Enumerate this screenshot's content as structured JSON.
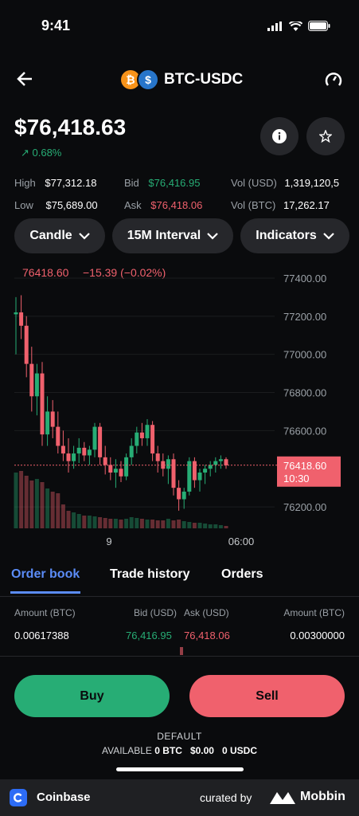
{
  "status": {
    "time": "9:41"
  },
  "header": {
    "pair": "BTC-USDC",
    "back_icon": "arrow-left-icon",
    "gauge_icon": "gauge-icon"
  },
  "price": {
    "value": "$76,418.63",
    "change": "↗ 0.68%"
  },
  "stats": {
    "high_label": "High",
    "high": "$77,312.18",
    "low_label": "Low",
    "low": "$75,689.00",
    "bid_label": "Bid",
    "bid": "$76,416.95",
    "ask_label": "Ask",
    "ask": "$76,418.06",
    "vol_usd_label": "Vol (USD)",
    "vol_usd": "1,319,120,5",
    "vol_btc_label": "Vol (BTC)",
    "vol_btc": "17,262.17"
  },
  "controls": {
    "candle": "Candle",
    "interval": "15M Interval",
    "indicators": "Indicators"
  },
  "chart_header": {
    "price": "76418.60",
    "change": "−15.39 (−0.02%)"
  },
  "chart_data": {
    "type": "candlestick",
    "y_ticks": [
      "77400.00",
      "77200.00",
      "77000.00",
      "76800.00",
      "76600.00",
      "76200.00"
    ],
    "x_ticks": [
      "9",
      "06:00"
    ],
    "current_price_label": "76418.60",
    "countdown_label": "10:30",
    "ylim": [
      76100,
      77450
    ],
    "candles": [
      [
        77210,
        77300,
        77000,
        77220
      ],
      [
        77220,
        77310,
        77080,
        77150
      ],
      [
        77150,
        77200,
        76880,
        76950
      ],
      [
        76950,
        77040,
        76700,
        76780
      ],
      [
        76780,
        76950,
        76680,
        76900
      ],
      [
        76900,
        76960,
        76520,
        76580
      ],
      [
        76580,
        76780,
        76520,
        76700
      ],
      [
        76700,
        76760,
        76560,
        76620
      ],
      [
        76620,
        76700,
        76480,
        76520
      ],
      [
        76520,
        76600,
        76440,
        76480
      ],
      [
        76480,
        76560,
        76380,
        76440
      ],
      [
        76440,
        76520,
        76400,
        76480
      ],
      [
        76480,
        76560,
        76430,
        76510
      ],
      [
        76510,
        76540,
        76440,
        76470
      ],
      [
        76470,
        76520,
        76420,
        76500
      ],
      [
        76500,
        76640,
        76460,
        76620
      ],
      [
        76620,
        76640,
        76420,
        76460
      ],
      [
        76460,
        76520,
        76370,
        76420
      ],
      [
        76420,
        76460,
        76340,
        76380
      ],
      [
        76380,
        76450,
        76300,
        76400
      ],
      [
        76400,
        76440,
        76330,
        76360
      ],
      [
        76360,
        76480,
        76340,
        76460
      ],
      [
        76460,
        76560,
        76420,
        76520
      ],
      [
        76520,
        76620,
        76480,
        76590
      ],
      [
        76590,
        76640,
        76520,
        76560
      ],
      [
        76560,
        76660,
        76520,
        76630
      ],
      [
        76630,
        76650,
        76440,
        76480
      ],
      [
        76480,
        76520,
        76380,
        76440
      ],
      [
        76440,
        76480,
        76360,
        76400
      ],
      [
        76400,
        76470,
        76320,
        76450
      ],
      [
        76450,
        76480,
        76260,
        76300
      ],
      [
        76300,
        76340,
        76180,
        76240
      ],
      [
        76240,
        76300,
        76190,
        76280
      ],
      [
        76280,
        76460,
        76260,
        76440
      ],
      [
        76440,
        76460,
        76300,
        76340
      ],
      [
        76340,
        76400,
        76280,
        76380
      ],
      [
        76380,
        76420,
        76320,
        76400
      ],
      [
        76400,
        76440,
        76360,
        76420
      ],
      [
        76420,
        76460,
        76380,
        76440
      ],
      [
        76440,
        76470,
        76400,
        76450
      ],
      [
        76450,
        76460,
        76400,
        76418
      ]
    ]
  },
  "tabs": [
    {
      "label": "Order book"
    },
    {
      "label": "Trade history"
    },
    {
      "label": "Orders"
    }
  ],
  "orderbook": {
    "head_amount_btc": "Amount (BTC)",
    "head_bid": "Bid (USD)",
    "head_ask": "Ask (USD)",
    "head_amount_right": "Amount (BTC)",
    "row_amount": "0.00617388",
    "row_bid": "76,416.95",
    "row_ask": "76,418.06",
    "row_amount_right": "0.00300000"
  },
  "actions": {
    "buy": "Buy",
    "sell": "Sell"
  },
  "balance": {
    "default": "DEFAULT",
    "available": "AVAILABLE",
    "btc": "0 BTC",
    "usd": "$0.00",
    "usdc": "0 USDC"
  },
  "footer": {
    "app": "Coinbase",
    "curated": "curated by",
    "brand": "Mobbin"
  },
  "colors": {
    "green": "#27ad75",
    "red": "#f0616d",
    "blue": "#5b8cf7",
    "bg": "#0a0b0d"
  }
}
